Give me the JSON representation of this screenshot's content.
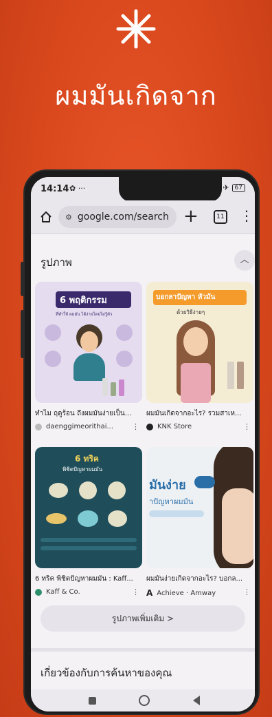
{
  "headline": "ผมมันเกิดจาก",
  "colors": {
    "background": "#d9481d",
    "accent": "#ffffff"
  },
  "status": {
    "time": "14:14",
    "time_suffix": "✿ ···",
    "signal": "▮▮▮ ✈ ",
    "battery": "67"
  },
  "browser": {
    "url": "google.com/search",
    "tab_count": "11"
  },
  "images_section": {
    "title": "รูปภาพ",
    "more_button": "รูปภาพเพิ่มเติม  >",
    "cards": [
      {
        "caption": "ทำไม ฤดูร้อน ถึงผมมันง่ายเป็น...",
        "source": "daenggimeorithai...",
        "thumb_title": "6 พฤติกรรม",
        "thumb_sub": "ที่ทำให้ ผมมัน ได้ง่ายโดยไม่รู้ตัว"
      },
      {
        "caption": "ผมมันเกิดจากอะไร? รวมสาเห...",
        "source": "KNK Store",
        "thumb_title": "บอกลาปัญหา หัวมัน",
        "thumb_sub": "ด้วยวิธีง่ายๆ"
      },
      {
        "caption": "6 ทริค พิชิตปัญหาผมมัน : Kaff...",
        "source": "Kaff & Co.",
        "thumb_title": "6 ทริค",
        "thumb_sub": "พิชิตปัญหาผมมัน"
      },
      {
        "caption": "ผมมันง่ายเกิดจากอะไร? บอกล...",
        "source": "Achieve · Amway",
        "thumb_title": "มันง่าย",
        "thumb_sub": "าปัญหาผมมัน"
      }
    ]
  },
  "related": {
    "title": "เกี่ยวข้องกับการค้นหาของคุณ"
  },
  "icons": [
    "asterisk-icon",
    "home-icon",
    "tune-icon",
    "plus-icon",
    "tabs-icon",
    "menu-icon",
    "chevron-up-icon",
    "more-vert-icon"
  ]
}
